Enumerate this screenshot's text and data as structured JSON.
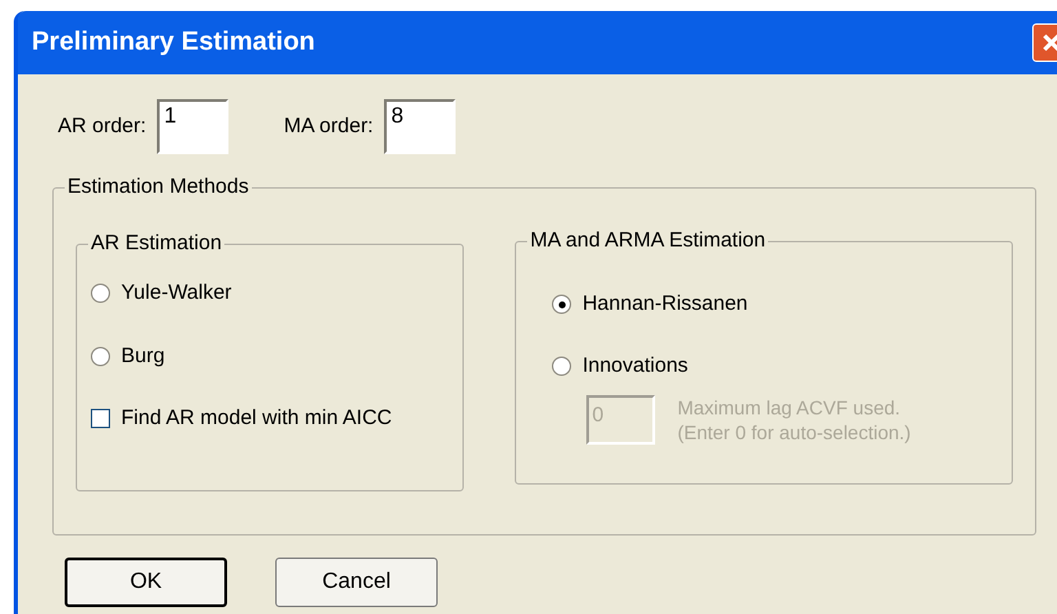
{
  "window": {
    "title": "Preliminary Estimation"
  },
  "orders": [
    {
      "label": "AR order:",
      "value": "1"
    },
    {
      "label": "MA order:",
      "value": "8"
    }
  ],
  "methods": {
    "title": "Estimation Methods",
    "ar": {
      "title": "AR Estimation",
      "options": [
        {
          "label": "Yule-Walker",
          "selected": false
        },
        {
          "label": "Burg",
          "selected": false
        }
      ],
      "checkbox": {
        "label": "Find AR model with min AICC",
        "checked": false
      }
    },
    "ma": {
      "title": "MA and ARMA Estimation",
      "options": [
        {
          "label": "Hannan-Rissanen",
          "selected": true
        },
        {
          "label": "Innovations",
          "selected": false
        }
      ],
      "lag": {
        "value": "0",
        "disabled": true,
        "hint": [
          "Maximum lag ACVF used.",
          "(Enter 0 for auto-selection.)"
        ]
      }
    }
  },
  "buttons": [
    {
      "label": "OK",
      "default": true
    },
    {
      "label": "Cancel",
      "default": false
    }
  ]
}
